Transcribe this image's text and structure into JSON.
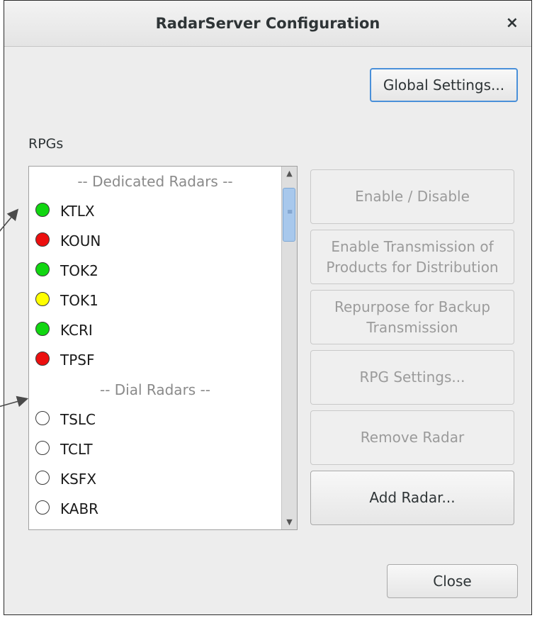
{
  "window": {
    "title": "RadarServer Configuration",
    "close_glyph": "×"
  },
  "buttons": {
    "global_settings": "Global Settings...",
    "enable_disable": "Enable / Disable",
    "enable_transmission": "Enable Transmission of Products for Distribution",
    "repurpose": "Repurpose for Backup Transmission",
    "rpg_settings": "RPG Settings...",
    "remove_radar": "Remove Radar",
    "add_radar": "Add Radar...",
    "close": "Close"
  },
  "rpgs_label": "RPGs",
  "rpg_list": [
    {
      "type": "header",
      "label": "-- Dedicated Radars --"
    },
    {
      "type": "radar",
      "label": "KTLX",
      "status": "green"
    },
    {
      "type": "radar",
      "label": "KOUN",
      "status": "red"
    },
    {
      "type": "radar",
      "label": "TOK2",
      "status": "green"
    },
    {
      "type": "radar",
      "label": "TOK1",
      "status": "yellow"
    },
    {
      "type": "radar",
      "label": "KCRI",
      "status": "green"
    },
    {
      "type": "radar",
      "label": "TPSF",
      "status": "red"
    },
    {
      "type": "header",
      "label": "-- Dial Radars --"
    },
    {
      "type": "radar",
      "label": "TSLC",
      "status": "none"
    },
    {
      "type": "radar",
      "label": "TCLT",
      "status": "none"
    },
    {
      "type": "radar",
      "label": "KSFX",
      "status": "none"
    },
    {
      "type": "radar",
      "label": "KABR",
      "status": "none"
    },
    {
      "type": "radar",
      "label": "",
      "status": "none"
    }
  ],
  "status_colors": {
    "green": "#11d611",
    "red": "#ec0f0f",
    "yellow": "#ffff00",
    "none": "#ffffff"
  }
}
